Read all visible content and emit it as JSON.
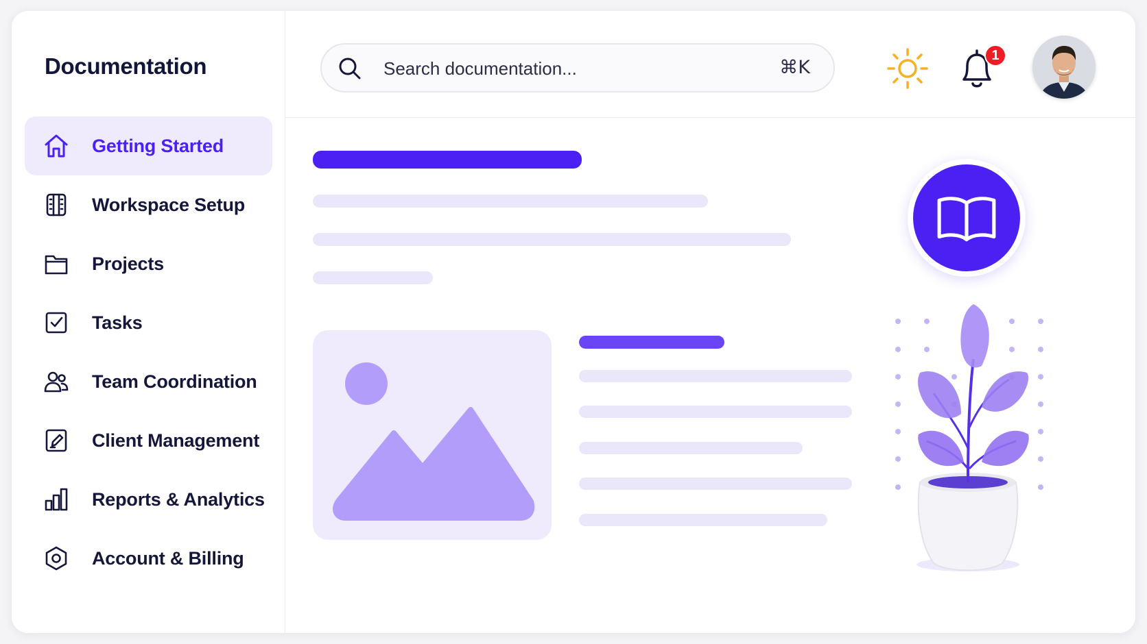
{
  "brand": {
    "title": "Documentation"
  },
  "sidebar": {
    "items": [
      {
        "label": "Getting Started",
        "icon": "home-icon",
        "active": true
      },
      {
        "label": "Workspace Setup",
        "icon": "building-icon",
        "active": false
      },
      {
        "label": "Projects",
        "icon": "folder-icon",
        "active": false
      },
      {
        "label": "Tasks",
        "icon": "checkbox-icon",
        "active": false
      },
      {
        "label": "Team Coordination",
        "icon": "users-icon",
        "active": false
      },
      {
        "label": "Client Management",
        "icon": "document-edit-icon",
        "active": false
      },
      {
        "label": "Reports & Analytics",
        "icon": "bar-chart-icon",
        "active": false
      },
      {
        "label": "Account & Billing",
        "icon": "hexagon-settings-icon",
        "active": false
      }
    ]
  },
  "search": {
    "placeholder": "Search documentation...",
    "shortcut": "⌘K"
  },
  "header": {
    "theme_icon": "sun-icon",
    "notifications_icon": "bell-icon",
    "notification_count": "1",
    "avatar": "user-avatar"
  },
  "main": {
    "hero_icon": "open-book-icon",
    "illustration": "potted-plant"
  },
  "colors": {
    "accent": "#4b21f3",
    "accent_light": "#efebfd",
    "placeholder": "#ebe7fb",
    "image_purple": "#b39dfa",
    "sun": "#f5b023",
    "badge": "#ee1c24",
    "text": "#14173a"
  }
}
